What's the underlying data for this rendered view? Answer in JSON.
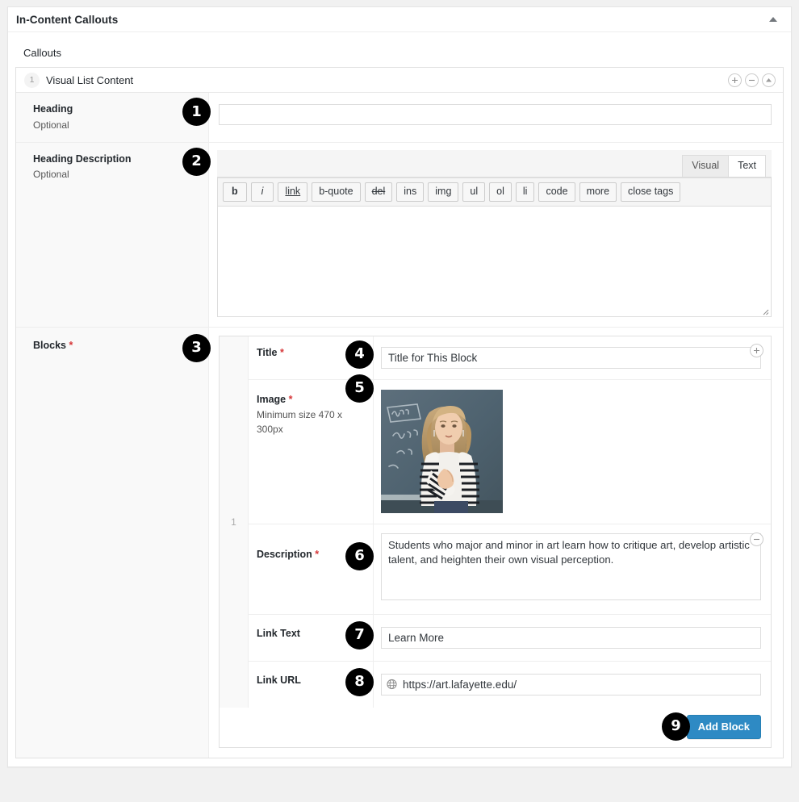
{
  "metabox": {
    "title": "In-Content Callouts",
    "toggle_icon": "chevron-up-icon",
    "section_label": "Callouts"
  },
  "repeater": {
    "row_index": "1",
    "row_title": "Visual List Content",
    "controls": [
      {
        "name": "add-row-button",
        "icon": "plus-icon"
      },
      {
        "name": "remove-row-button",
        "icon": "minus-icon"
      },
      {
        "name": "collapse-row-button",
        "icon": "triangle-up-icon"
      }
    ]
  },
  "fields": {
    "heading": {
      "label": "Heading",
      "desc": "Optional",
      "badge": "1",
      "value": "",
      "placeholder": ""
    },
    "heading_description": {
      "label": "Heading Description",
      "desc": "Optional",
      "badge": "2",
      "editor": {
        "tabs": [
          {
            "label": "Visual",
            "active": false
          },
          {
            "label": "Text",
            "active": true
          }
        ],
        "quicktags": [
          "b",
          "i",
          "link",
          "b-quote",
          "del",
          "ins",
          "img",
          "ul",
          "ol",
          "li",
          "code",
          "more",
          "close tags"
        ],
        "content": ""
      }
    },
    "blocks": {
      "label": "Blocks",
      "required": "*",
      "badge": "3",
      "row_number": "1",
      "add_icon": "plus-icon",
      "remove_icon": "minus-icon",
      "title": {
        "label": "Title",
        "required": "*",
        "badge": "4",
        "value": "Title for This Block"
      },
      "image": {
        "label": "Image",
        "required": "*",
        "desc": "Minimum size 470 x 300px",
        "badge": "5",
        "alt": "Woman in striped blazer teaching in front of a chalkboard"
      },
      "description": {
        "label": "Description",
        "required": "*",
        "badge": "6",
        "value": "Students who major and minor in art learn how to critique art, develop artistic talent, and heighten their own visual perception."
      },
      "link_text": {
        "label": "Link Text",
        "badge": "7",
        "value": "Learn More"
      },
      "link_url": {
        "label": "Link URL",
        "badge": "8",
        "icon": "globe-icon",
        "value": "https://art.lafayette.edu/"
      },
      "footer": {
        "badge": "9",
        "add_block_label": "Add Block"
      }
    }
  },
  "colors": {
    "accent_blue": "#2e8ac4",
    "required_red": "#d63638",
    "badge_black": "#000000",
    "label_bg": "#f9f9f9",
    "page_bg": "#f1f1f1"
  }
}
